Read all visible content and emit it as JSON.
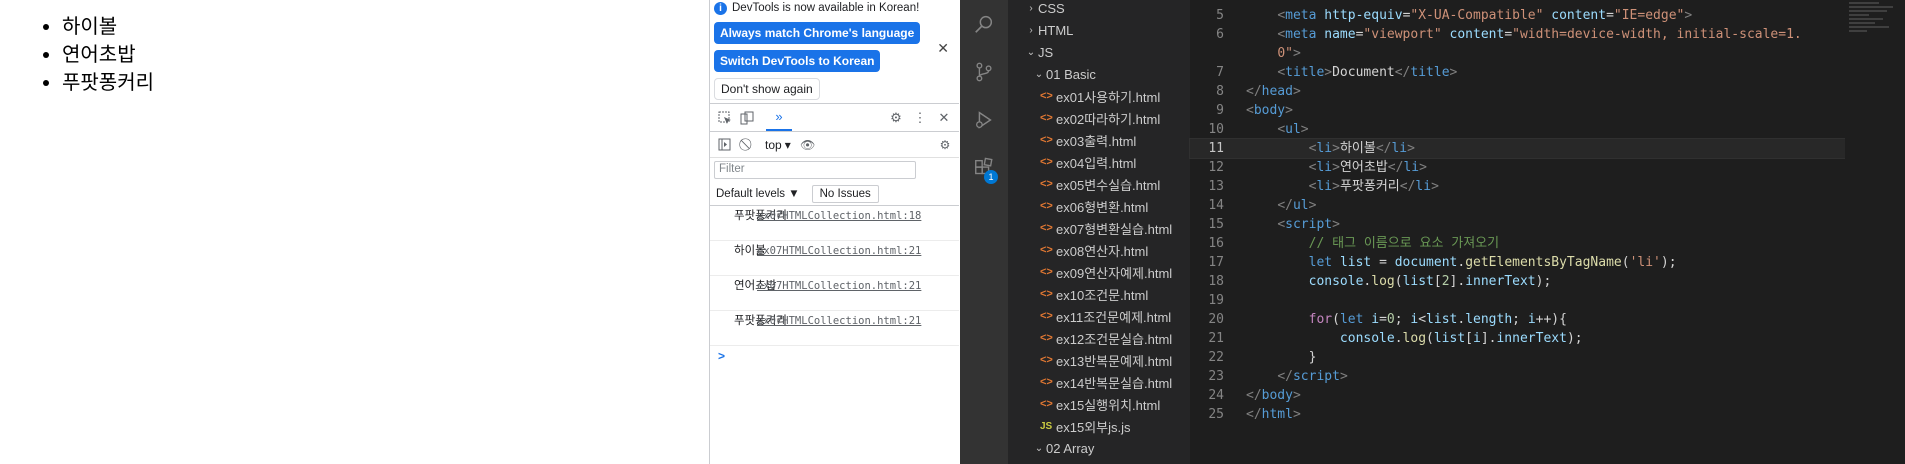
{
  "page": {
    "list": [
      "하이볼",
      "연어초밥",
      "푸팟퐁커리"
    ]
  },
  "devtools": {
    "banner": {
      "message": "DevTools is now available in Korean!",
      "match_button": "Always match Chrome's language",
      "switch_button": "Switch DevTools to Korean",
      "dismiss_button": "Don't show again"
    },
    "context": "top",
    "filter_placeholder": "Filter",
    "levels": "Default levels ▼",
    "issues": "No Issues",
    "logs": [
      {
        "text": "푸팟퐁커리",
        "source": "ex07HTMLCollection.html:18"
      },
      {
        "text": "하이볼",
        "source": "ex07HTMLCollection.html:21"
      },
      {
        "text": "연어초밥",
        "source": "ex07HTMLCollection.html:21"
      },
      {
        "text": "푸팟퐁커리",
        "source": "ex07HTMLCollection.html:21"
      }
    ],
    "prompt": ">"
  },
  "vscode": {
    "explorer": {
      "folders_top": [
        "CSS",
        "HTML",
        "JS"
      ],
      "subfolder": "01 Basic",
      "files": [
        {
          "name": "ex01사용하기.html",
          "type": "html"
        },
        {
          "name": "ex02따라하기.html",
          "type": "html"
        },
        {
          "name": "ex03출력.html",
          "type": "html"
        },
        {
          "name": "ex04입력.html",
          "type": "html"
        },
        {
          "name": "ex05변수실습.html",
          "type": "html"
        },
        {
          "name": "ex06형변환.html",
          "type": "html"
        },
        {
          "name": "ex07형변환실습.html",
          "type": "html"
        },
        {
          "name": "ex08연산자.html",
          "type": "html"
        },
        {
          "name": "ex09연산자예제.html",
          "type": "html"
        },
        {
          "name": "ex10조건문.html",
          "type": "html"
        },
        {
          "name": "ex11조건문예제.html",
          "type": "html"
        },
        {
          "name": "ex12조건문실습.html",
          "type": "html"
        },
        {
          "name": "ex13반복문예제.html",
          "type": "html"
        },
        {
          "name": "ex14반복문실습.html",
          "type": "html"
        },
        {
          "name": "ex15실행위치.html",
          "type": "html"
        },
        {
          "name": "ex15외부js.js",
          "type": "js"
        }
      ],
      "folder_bottom": "02 Array"
    },
    "source_control_badge": "1",
    "line_numbers": [
      "5",
      "6",
      "",
      "7",
      "8",
      "9",
      "10",
      "11",
      "12",
      "13",
      "14",
      "15",
      "16",
      "17",
      "18",
      "19",
      "20",
      "21",
      "22",
      "23",
      "24",
      "25"
    ],
    "current_line": "11"
  }
}
